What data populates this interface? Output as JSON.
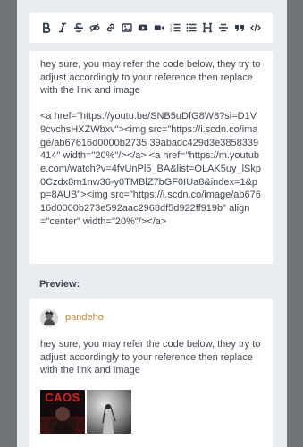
{
  "toolbar": {
    "buttons": [
      {
        "name": "bold-icon",
        "label": "Bold"
      },
      {
        "name": "italic-icon",
        "label": "Italic"
      },
      {
        "name": "strikethrough-icon",
        "label": "Strikethrough"
      },
      {
        "name": "spoiler-icon",
        "label": "Spoiler"
      },
      {
        "name": "link-icon",
        "label": "Link"
      },
      {
        "name": "image-icon",
        "label": "Image"
      },
      {
        "name": "youtube-icon",
        "label": "YouTube"
      },
      {
        "name": "video-icon",
        "label": "Video"
      },
      {
        "name": "ordered-list-icon",
        "label": "Numbered list"
      },
      {
        "name": "unordered-list-icon",
        "label": "Bulleted list"
      },
      {
        "name": "heading-icon",
        "label": "Heading"
      },
      {
        "name": "horizontal-rule-icon",
        "label": "Horizontal rule"
      },
      {
        "name": "quote-icon",
        "label": "Quote"
      },
      {
        "name": "code-icon",
        "label": "Code"
      }
    ]
  },
  "editor": {
    "intro": "hey sure, you may refer the code below, they try to adjust accordingly to your reference then replace with the link and image",
    "code": "<a href=\"https://youtu.be/SNB5uDfG8W8?si=D1V9cvchsHXZWbxv\"><img src=\"https://i.scdn.co/image/ab67616d0000b2735 39abadc429d3e3858339414\" width=\"20%\"/></a> <a href=\"https://m.youtube.com/watch?v=4fvUnPl5_BA&list=OLAK5uy_lSkp0Czdx8m1nw36-y0TMBlZ7bGF0IUa8&index=1&pp=8AUB\"><img src=\"https://i.scdn.co/image/ab67616d0000b273e592aac2968df5d922ff919b\" align=\"center\" width=\"20%\"/></a>"
  },
  "preview": {
    "label": "Preview:",
    "username": "pandeho",
    "text": "hey sure, you may refer the code below, they try to adjust accordingly to your reference then replace with the link and image",
    "thumb1_caption": "CAOS"
  },
  "colors": {
    "background": "#6f7276",
    "panel": "#e9edf2",
    "card": "#ffffff",
    "username": "#c98a2a"
  }
}
